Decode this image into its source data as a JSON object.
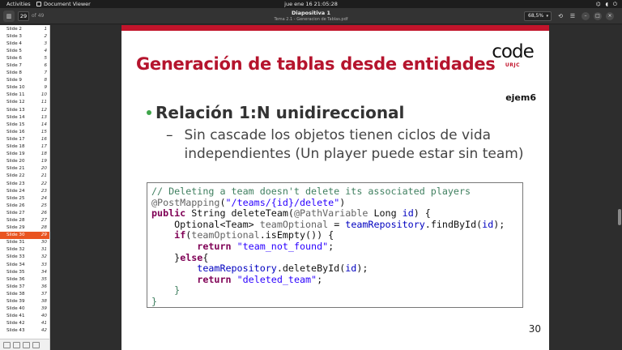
{
  "topbar": {
    "activities": "Activities",
    "app_name": "Document Viewer",
    "clock": "jue ene 16  21:05:28"
  },
  "header": {
    "current_page": "29",
    "page_of": "of 49",
    "doc_title": "Diapositiva 1",
    "doc_subtitle": "Tema 2.1 - Generacion de Tablas.pdf",
    "zoom": "68,5%"
  },
  "sidebar": {
    "selected_index": 28,
    "items": [
      {
        "label": "Slide 2",
        "num": "1"
      },
      {
        "label": "Slide 3",
        "num": "2"
      },
      {
        "label": "Slide 4",
        "num": "3"
      },
      {
        "label": "Slide 5",
        "num": "4"
      },
      {
        "label": "Slide 6",
        "num": "5"
      },
      {
        "label": "Slide 7",
        "num": "6"
      },
      {
        "label": "Slide 8",
        "num": "7"
      },
      {
        "label": "Slide 9",
        "num": "8"
      },
      {
        "label": "Slide 10",
        "num": "9"
      },
      {
        "label": "Slide 11",
        "num": "10"
      },
      {
        "label": "Slide 12",
        "num": "11"
      },
      {
        "label": "Slide 13",
        "num": "12"
      },
      {
        "label": "Slide 14",
        "num": "13"
      },
      {
        "label": "Slide 15",
        "num": "14"
      },
      {
        "label": "Slide 16",
        "num": "15"
      },
      {
        "label": "Slide 17",
        "num": "16"
      },
      {
        "label": "Slide 18",
        "num": "17"
      },
      {
        "label": "Slide 19",
        "num": "18"
      },
      {
        "label": "Slide 20",
        "num": "19"
      },
      {
        "label": "Slide 21",
        "num": "20"
      },
      {
        "label": "Slide 22",
        "num": "21"
      },
      {
        "label": "Slide 23",
        "num": "22"
      },
      {
        "label": "Slide 24",
        "num": "23"
      },
      {
        "label": "Slide 25",
        "num": "24"
      },
      {
        "label": "Slide 26",
        "num": "25"
      },
      {
        "label": "Slide 27",
        "num": "26"
      },
      {
        "label": "Slide 28",
        "num": "27"
      },
      {
        "label": "Slide 29",
        "num": "28"
      },
      {
        "label": "Slide 30",
        "num": "29"
      },
      {
        "label": "Slide 31",
        "num": "30"
      },
      {
        "label": "Slide 32",
        "num": "31"
      },
      {
        "label": "Slide 33",
        "num": "32"
      },
      {
        "label": "Slide 34",
        "num": "33"
      },
      {
        "label": "Slide 35",
        "num": "34"
      },
      {
        "label": "Slide 36",
        "num": "35"
      },
      {
        "label": "Slide 37",
        "num": "36"
      },
      {
        "label": "Slide 38",
        "num": "37"
      },
      {
        "label": "Slide 39",
        "num": "38"
      },
      {
        "label": "Slide 40",
        "num": "39"
      },
      {
        "label": "Slide 41",
        "num": "40"
      },
      {
        "label": "Slide 42",
        "num": "41"
      },
      {
        "label": "Slide 43",
        "num": "42"
      }
    ]
  },
  "slide": {
    "title": "Generación de tablas desde entidades",
    "logo_word": "code",
    "logo_sub": "URJC",
    "tag": "ejem6",
    "bullet": "Relación 1:N unidireccional",
    "sub_bullet_dash": "–",
    "sub_bullet": "Sin cascade los objetos tienen ciclos de vida independientes (Un player puede estar sin team)",
    "page_number": "30",
    "code_lines": [
      [
        {
          "t": "// Deleting a team doesn't delete its associated players",
          "c": "com"
        }
      ],
      [
        {
          "t": "@PostMapping",
          "c": "ann"
        },
        {
          "t": "(",
          "c": ""
        },
        {
          "t": "\"/teams/{id}/delete\"",
          "c": "str"
        },
        {
          "t": ")",
          "c": ""
        }
      ],
      [
        {
          "t": "public",
          "c": "kw"
        },
        {
          "t": " String deleteTeam(",
          "c": ""
        },
        {
          "t": "@PathVariable",
          "c": "ann"
        },
        {
          "t": " Long ",
          "c": ""
        },
        {
          "t": "id",
          "c": "var"
        },
        {
          "t": ") {",
          "c": ""
        }
      ],
      [
        {
          "t": "    Optional<Team> ",
          "c": ""
        },
        {
          "t": "teamOptional",
          "c": "ann"
        },
        {
          "t": " = ",
          "c": ""
        },
        {
          "t": "teamRepository",
          "c": "var"
        },
        {
          "t": ".findById(",
          "c": ""
        },
        {
          "t": "id",
          "c": "var"
        },
        {
          "t": ");",
          "c": ""
        }
      ],
      [
        {
          "t": "    ",
          "c": ""
        },
        {
          "t": "if",
          "c": "kw"
        },
        {
          "t": "(",
          "c": ""
        },
        {
          "t": "teamOptional",
          "c": "ann"
        },
        {
          "t": ".isEmpty()) {",
          "c": ""
        }
      ],
      [
        {
          "t": "        ",
          "c": ""
        },
        {
          "t": "return",
          "c": "kw"
        },
        {
          "t": " ",
          "c": ""
        },
        {
          "t": "\"team_not_found\"",
          "c": "str"
        },
        {
          "t": ";",
          "c": ""
        }
      ],
      [
        {
          "t": "    }",
          "c": ""
        },
        {
          "t": "else",
          "c": "kw"
        },
        {
          "t": "{",
          "c": ""
        }
      ],
      [
        {
          "t": "        ",
          "c": ""
        },
        {
          "t": "teamRepository",
          "c": "var"
        },
        {
          "t": ".deleteById(",
          "c": ""
        },
        {
          "t": "id",
          "c": "var"
        },
        {
          "t": ");",
          "c": ""
        }
      ],
      [
        {
          "t": "        ",
          "c": ""
        },
        {
          "t": "return",
          "c": "kw"
        },
        {
          "t": " ",
          "c": ""
        },
        {
          "t": "\"deleted_team\"",
          "c": "str"
        },
        {
          "t": ";",
          "c": ""
        }
      ],
      [
        {
          "t": "    }",
          "c": "com"
        }
      ],
      [
        {
          "t": "}",
          "c": "com"
        }
      ]
    ]
  },
  "colors": {
    "accent": "#e95420",
    "title_red": "#b5142d",
    "bullet_green": "#3fa54a"
  }
}
